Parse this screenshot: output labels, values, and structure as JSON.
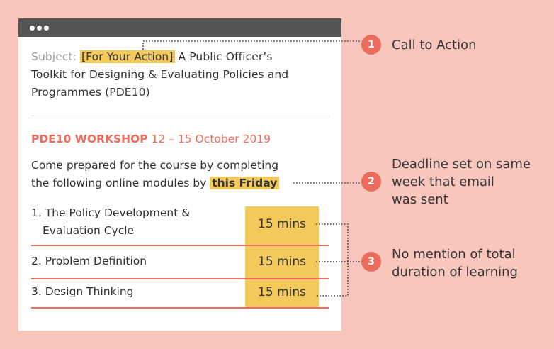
{
  "email": {
    "subject_label": "Subject:",
    "subject_tag": "[For Your Action]",
    "subject_line1_rest": " A Public Officer’s",
    "subject_line2": "Toolkit for Designing & Evaluating Policies and",
    "subject_line3": "Programmes (PDE10)",
    "workshop_label": "PDE10 WORKSHOP",
    "workshop_dates": " 12 – 15 October 2019",
    "intro_line1": "Come prepared for the course by completing",
    "intro_line2_before": "the following online modules by ",
    "intro_deadline": "this Friday",
    "modules": [
      {
        "label_line1": "1. The Policy Development &",
        "label_line2": "Evaluation Cycle",
        "time": "15 mins"
      },
      {
        "label_line1": "2. Problem Definition",
        "time": "15 mins"
      },
      {
        "label_line1": "3. Design Thinking",
        "time": "15 mins"
      }
    ]
  },
  "callouts": [
    {
      "number": "1",
      "text": "Call to Action"
    },
    {
      "number": "2",
      "line1": "Deadline set on same",
      "line2": "week that email",
      "line3": "was sent"
    },
    {
      "number": "3",
      "line1": "No mention of total",
      "line2": "duration of learning"
    }
  ],
  "colors": {
    "background": "#f8c6bd",
    "highlight": "#f3c95c",
    "accent": "#f06d5d",
    "badge": "#ea6a5c",
    "titlebar": "#555555"
  }
}
